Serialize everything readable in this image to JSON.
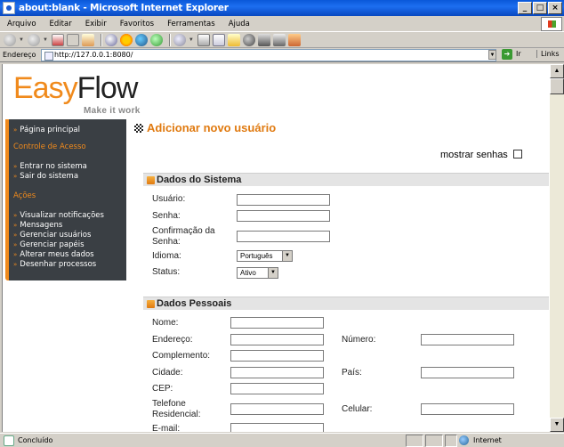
{
  "window": {
    "title": "about:blank - Microsoft Internet Explorer",
    "controls": [
      "_",
      "□",
      "×"
    ]
  },
  "menubar": [
    "Arquivo",
    "Editar",
    "Exibir",
    "Favoritos",
    "Ferramentas",
    "Ajuda"
  ],
  "addressbar": {
    "label": "Endereço",
    "url": "http://127.0.0.1:8080/",
    "go_label": "Ir",
    "links_label": "Links"
  },
  "logo": {
    "easy": "Easy",
    "flow": "Flow",
    "tagline": "Make it work"
  },
  "sidebar": {
    "home": "Página principal",
    "access_heading": "Controle de Acesso",
    "login": "Entrar no sistema",
    "logout": "Sair do sistema",
    "actions_heading": "Ações",
    "actions": [
      "Visualizar notificações",
      "Mensagens",
      "Gerenciar usuários",
      "Gerenciar papéis",
      "Alterar meus dados",
      "Desenhar processos"
    ]
  },
  "page": {
    "title": "Adicionar novo usuário",
    "show_passwords": "mostrar senhas"
  },
  "system_section": {
    "title": "Dados do Sistema",
    "user_label": "Usuário:",
    "user_value": "",
    "password_label": "Senha:",
    "password_value": "",
    "confirm_label_1": "Confirmação da",
    "confirm_label_2": "Senha:",
    "confirm_value": "",
    "language_label": "Idioma:",
    "language_value": "Português",
    "status_label": "Status:",
    "status_value": "Ativo"
  },
  "personal_section": {
    "title": "Dados Pessoais",
    "name_label": "Nome:",
    "address_label": "Endereço:",
    "number_label": "Número:",
    "complement_label": "Complemento:",
    "city_label": "Cidade:",
    "country_label": "País:",
    "zip_label": "CEP:",
    "home_phone_label_1": "Telefone",
    "home_phone_label_2": "Residencial:",
    "mobile_label": "Celular:",
    "email_label": "E-mail:"
  },
  "statusbar": {
    "text": "Concluído",
    "zone": "Internet"
  }
}
